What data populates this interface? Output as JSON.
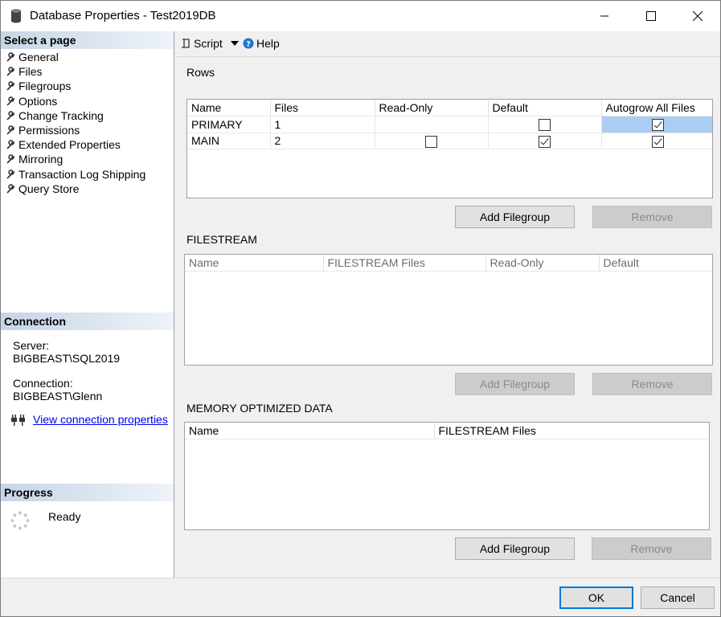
{
  "window": {
    "title": "Database Properties - Test2019DB",
    "min_label": "─",
    "max_label": "☐",
    "close_label": "✕"
  },
  "sidebar": {
    "select_page_header": "Select a page",
    "pages": [
      "General",
      "Files",
      "Filegroups",
      "Options",
      "Change Tracking",
      "Permissions",
      "Extended Properties",
      "Mirroring",
      "Transaction Log Shipping",
      "Query Store"
    ],
    "active_page": "Filegroups",
    "connection_header": "Connection",
    "server_label": "Server:",
    "server_value": "BIGBEAST\\SQL2019",
    "connection_label": "Connection:",
    "connection_value": "BIGBEAST\\Glenn",
    "view_connection_link": "View connection properties",
    "progress_header": "Progress",
    "progress_status": "Ready"
  },
  "toolbar": {
    "script_label": "Script",
    "help_label": "Help"
  },
  "rows_section": {
    "label": "Rows",
    "columns": [
      "Name",
      "Files",
      "Read-Only",
      "Default",
      "Autogrow All Files"
    ],
    "rows": [
      {
        "name": "PRIMARY",
        "files": "1",
        "read_only": null,
        "default": false,
        "autogrow": true
      },
      {
        "name": "MAIN",
        "files": "2",
        "read_only": false,
        "default": true,
        "autogrow": true
      }
    ],
    "add_button": "Add Filegroup",
    "remove_button": "Remove"
  },
  "filestream_section": {
    "label": "FILESTREAM",
    "columns": [
      "Name",
      "FILESTREAM Files",
      "Read-Only",
      "Default"
    ],
    "add_button": "Add Filegroup",
    "remove_button": "Remove"
  },
  "memory_section": {
    "label": "MEMORY OPTIMIZED DATA",
    "columns": [
      "Name",
      "FILESTREAM Files"
    ],
    "add_button": "Add Filegroup",
    "remove_button": "Remove"
  },
  "footer": {
    "ok_label": "OK",
    "cancel_label": "Cancel"
  },
  "colors": {
    "accent": "#0078d7",
    "selection": "#aacdf3",
    "header_gradient_start": "#c6d5e6"
  }
}
